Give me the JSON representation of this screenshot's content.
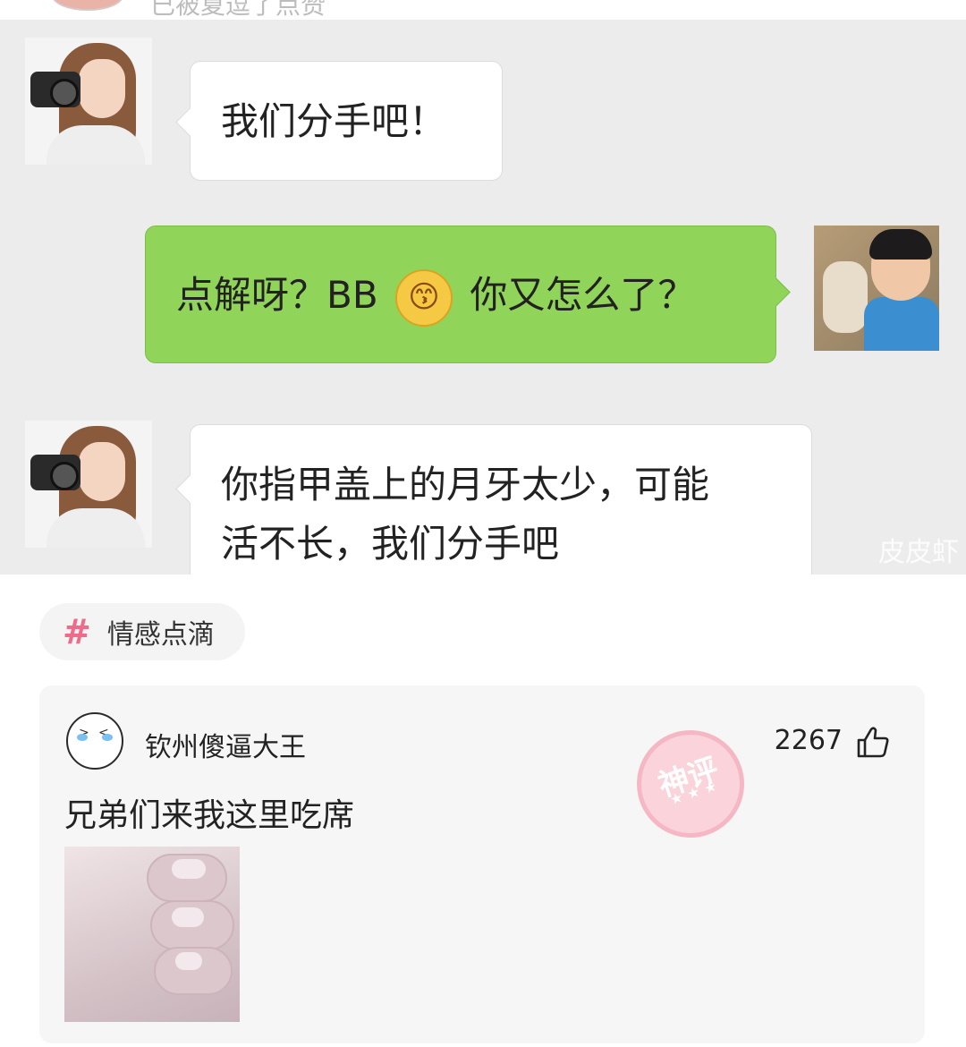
{
  "top_strip": {
    "text": "已被夏逗了点赞"
  },
  "chat": {
    "messages": [
      {
        "side": "left",
        "text": "我们分手吧！"
      },
      {
        "side": "right",
        "text_before": "点解呀？BB",
        "emoji": "😙",
        "text_after": "你又怎么了？"
      },
      {
        "side": "left",
        "lines": [
          "你指甲盖上的月牙太少，可能",
          "活不长，我们分手吧"
        ]
      }
    ],
    "watermark": "皮皮虾",
    "bubble_colors": {
      "white": "#ffffff",
      "green": "#91d45a"
    }
  },
  "topic": {
    "hash": "#",
    "label": "情感点滴",
    "hash_color": "#f06a8a"
  },
  "comment": {
    "username": "钦州傻逼大王",
    "likes": "2267",
    "text": "兄弟们来我这里吃席",
    "badge": "神评",
    "badge_stars": "★ ★ ★",
    "icons": {
      "like": "thumbs-up-icon"
    }
  }
}
